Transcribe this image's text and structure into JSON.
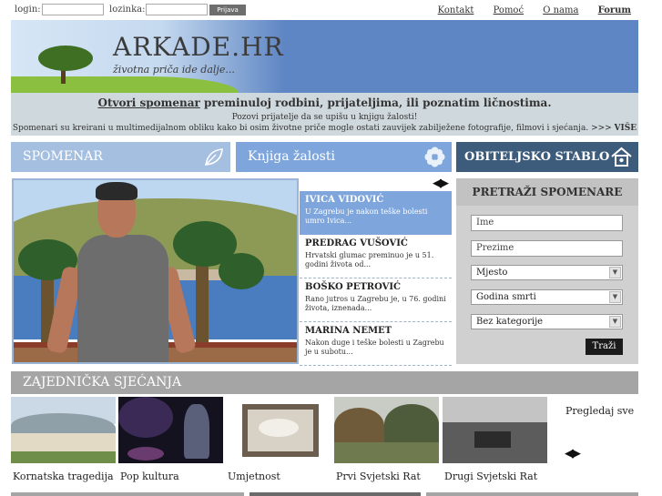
{
  "login": {
    "login_label": "login:",
    "password_label": "lozinka:",
    "button_label": "Prijava"
  },
  "top_links": [
    "Kontakt",
    "Pomoć",
    "O nama",
    "Forum"
  ],
  "header": {
    "logo": "ARKADE.HR",
    "slogan": "životna priča ide dalje..."
  },
  "intro": {
    "link_text": "Otvori spomenar",
    "line1_rest": " preminuloj rodbini, prijateljima, ili poznatim ličnostima.",
    "line2": "Pozovi prijatelje da se upišu u knjigu žalosti!",
    "line3": "Spomenari su kreirani u multimedijalnom obliku kako bi osim životne priče mogle ostati zauvijek zabilježene fotografije, filmovi i sjećanja. >>> ",
    "more": "VIŠE"
  },
  "nav": {
    "item1": "SPOMENAR",
    "item2": "Knjiga žalosti",
    "item3": "OBITELJSKO STABLO"
  },
  "people": [
    {
      "name": "IVICA VIDOVIĆ",
      "desc": "U Zagrebu je nakon teške bolesti umro Ivica..."
    },
    {
      "name": "PREDRAG VUŠOVIĆ",
      "desc": "Hrvatski glumac preminuo je u 51. godini života od..."
    },
    {
      "name": "BOŠKO PETROVIĆ",
      "desc": "Rano jutros u Zagrebu je, u 76. godini života, iznenada..."
    },
    {
      "name": "MARINA NEMET",
      "desc": "Nakon duge i teške bolesti u Zagrebu je u subotu..."
    }
  ],
  "search": {
    "title": "PRETRAŽI SPOMENARE",
    "name_placeholder": "Ime",
    "surname_placeholder": "Prezime",
    "place_select": "Mjesto",
    "year_select": "Godina smrti",
    "category_select": "Bez kategorije",
    "button": "Traži"
  },
  "shared": {
    "title": "ZAJEDNIČKA SJEĆANJA",
    "see_all": "Pregledaj sve",
    "items": [
      "Kornatska tragedija",
      "Pop kultura",
      "Umjetnost",
      "Prvi Svjetski Rat",
      "Drugi Svjetski Rat"
    ]
  },
  "arrow_glyphs": "◀▶",
  "colors": {
    "header_blue": "#5f86c4",
    "nav_light": "#a5bfe0",
    "nav_mid": "#7ea6dd",
    "nav_dark": "#3d5b7a",
    "active_item": "#7ea6dd"
  },
  "icons": {
    "nav1": "leaf-icon",
    "nav2": "flower-icon",
    "nav3": "house-icon"
  }
}
